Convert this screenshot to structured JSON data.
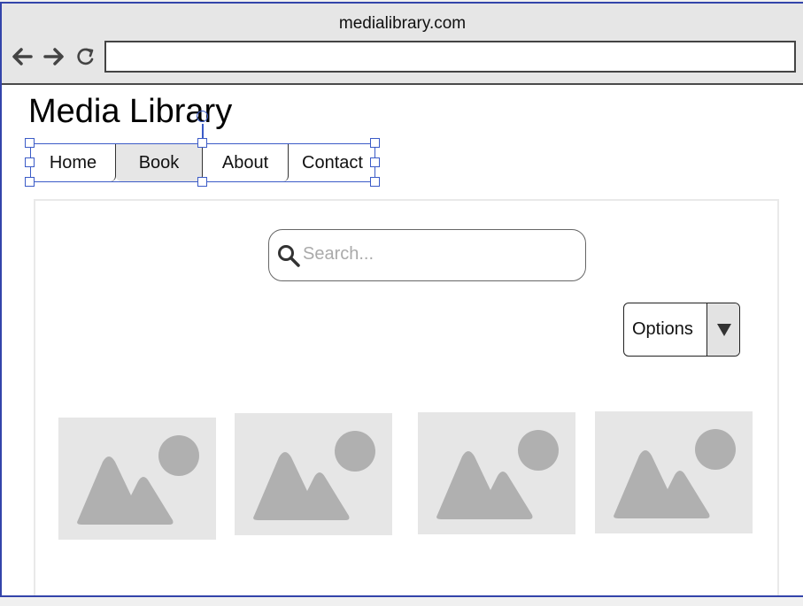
{
  "browser": {
    "domain": "medialibrary.com",
    "url_value": "",
    "back_icon": "arrow-left-icon",
    "forward_icon": "arrow-right-icon",
    "reload_icon": "reload-icon"
  },
  "page": {
    "title": "Media Library"
  },
  "nav": {
    "tabs": [
      {
        "label": "Home"
      },
      {
        "label": "Book",
        "selected": true
      },
      {
        "label": "About"
      },
      {
        "label": "Contact"
      }
    ]
  },
  "search": {
    "placeholder": "Search...",
    "icon": "search-icon"
  },
  "options": {
    "label": "Options",
    "icon": "triangle-down-icon"
  },
  "gallery": {
    "images": [
      {
        "icon": "image-placeholder-icon"
      },
      {
        "icon": "image-placeholder-icon"
      },
      {
        "icon": "image-placeholder-icon"
      },
      {
        "icon": "image-placeholder-icon"
      }
    ]
  },
  "colors": {
    "selection": "#3b5bc7",
    "chrome": "#e6e6e6",
    "placeholder_fill": "#e6e6e6",
    "placeholder_shape": "#b0b0b0"
  }
}
